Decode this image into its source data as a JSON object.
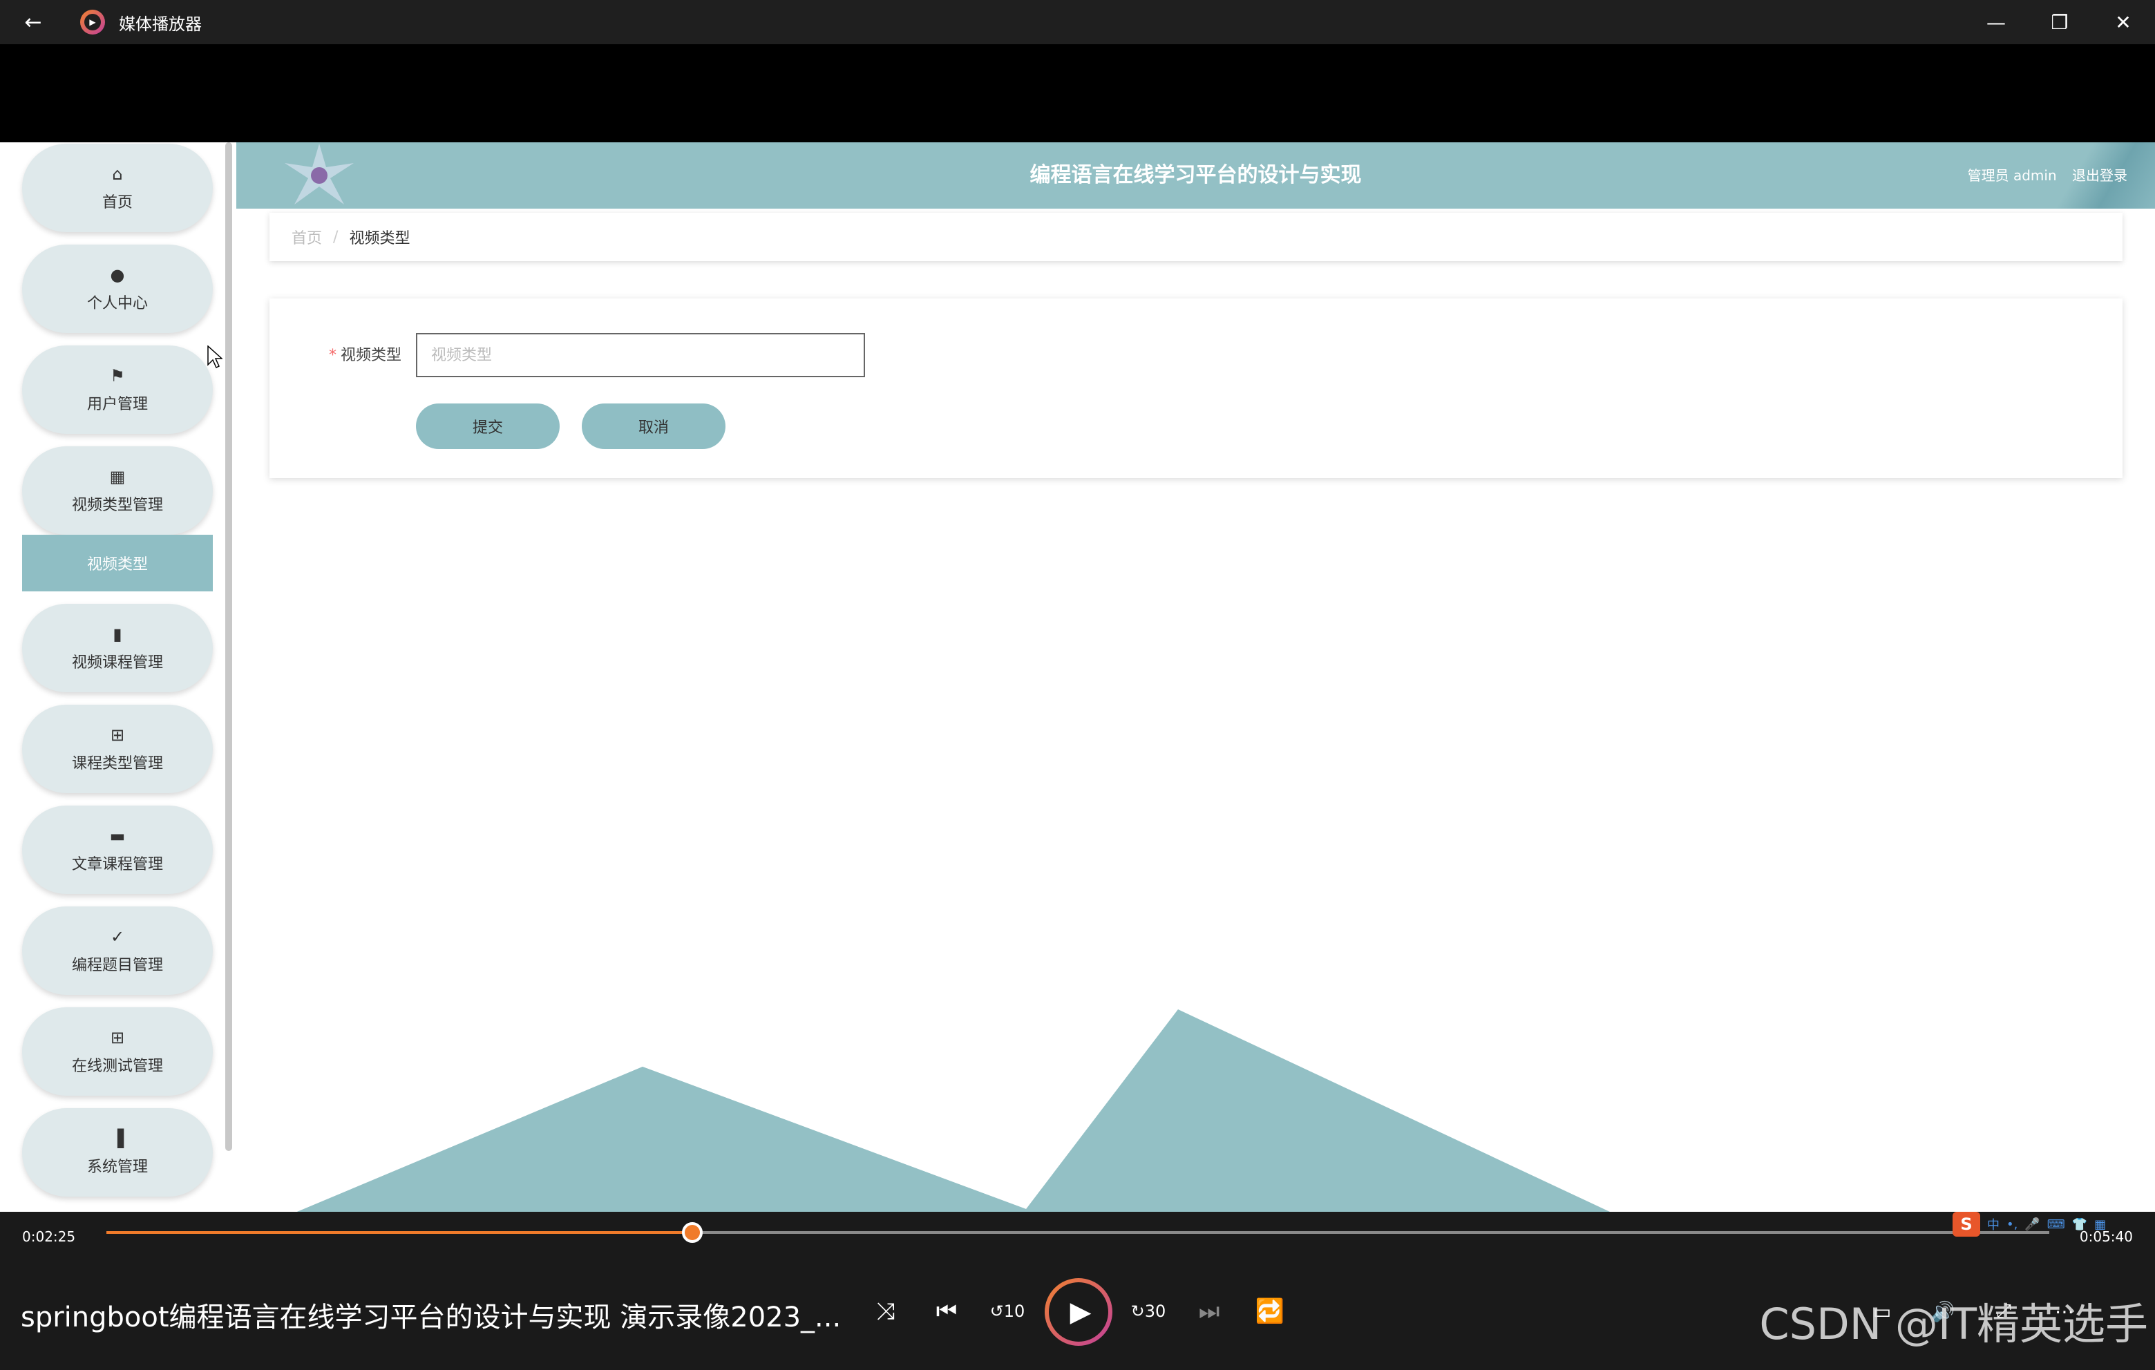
{
  "player": {
    "app_title": "媒体播放器",
    "back_icon": "back-arrow-icon",
    "minimize_icon": "minimize-icon",
    "restore_icon": "restore-icon",
    "close_icon": "close-icon",
    "current_time": "0:02:25",
    "total_time": "0:05:40",
    "progress": 0.3015,
    "media_title": "springboot编程语言在线学习平台的设计与实现  演示录像2023_...",
    "ime_label": "中",
    "watermark": "CSDN @IT精英选手",
    "accent_color": "#f07b2a"
  },
  "app": {
    "header_title": "编程语言在线学习平台的设计与实现",
    "user_label": "管理员 admin",
    "logout_label": "退出登录",
    "theme_color": "#93c0c5"
  },
  "sidebar": {
    "items": [
      {
        "label": "首页",
        "icon": "home-icon"
      },
      {
        "label": "个人中心",
        "icon": "user-icon"
      },
      {
        "label": "用户管理",
        "icon": "flag-icon"
      },
      {
        "label": "视频类型管理",
        "icon": "grid-icon"
      },
      {
        "label": "视频课程管理",
        "icon": "book-icon"
      },
      {
        "label": "课程类型管理",
        "icon": "apps-icon"
      },
      {
        "label": "文章课程管理",
        "icon": "briefcase-icon"
      },
      {
        "label": "编程题目管理",
        "icon": "clipboard-icon"
      },
      {
        "label": "在线测试管理",
        "icon": "apps-icon"
      },
      {
        "label": "系统管理",
        "icon": "bar-chart-icon"
      }
    ],
    "submenu_active": "视频类型"
  },
  "breadcrumb": {
    "home": "首页",
    "separator": "/",
    "current": "视频类型"
  },
  "form": {
    "required_mark": "*",
    "field_label": "视频类型",
    "field_placeholder": "视频类型",
    "field_value": "",
    "submit_label": "提交",
    "cancel_label": "取消"
  }
}
